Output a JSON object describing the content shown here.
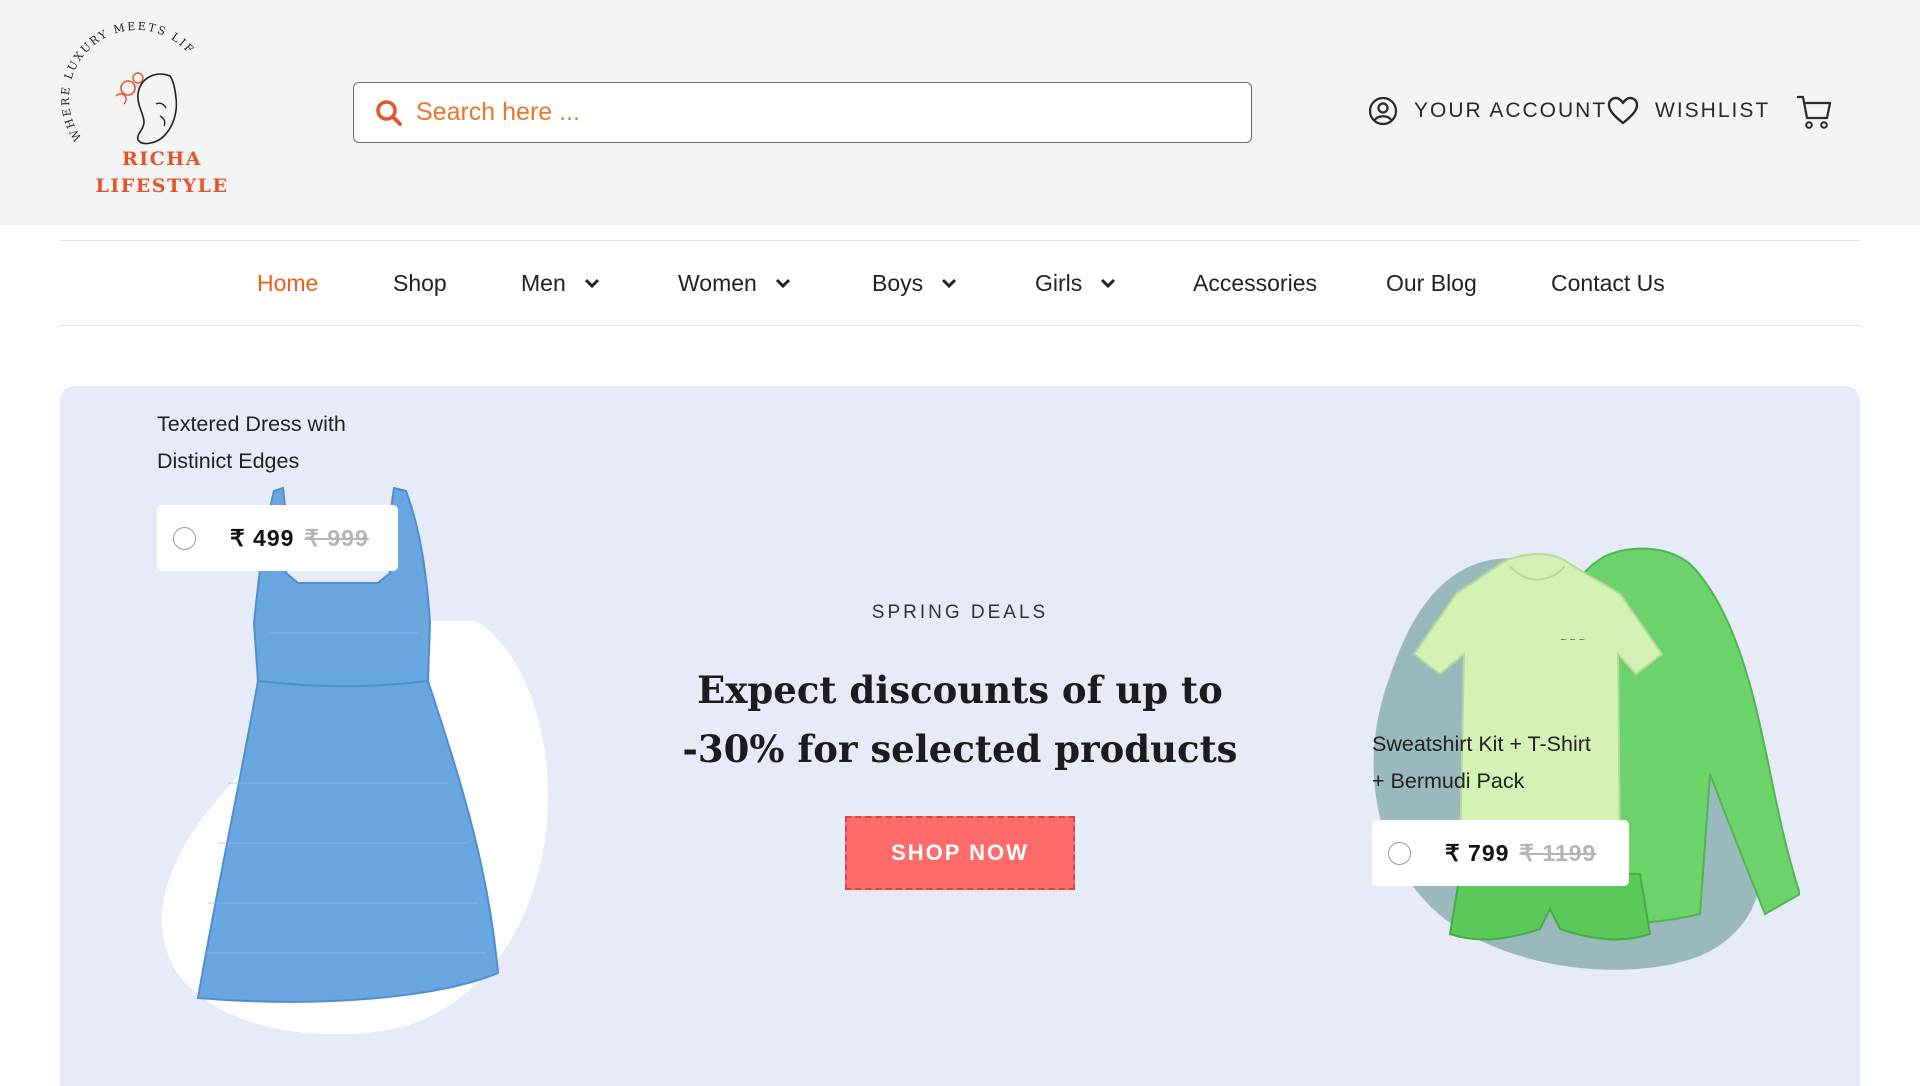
{
  "brand": {
    "name_line1": "RICHA",
    "name_line2": "LIFESTYLE",
    "tagline": "WHERE LUXURY MEETS LIFESTYLE",
    "accent_color": "#e2552a"
  },
  "search": {
    "placeholder": "Search here ...",
    "value": ""
  },
  "header_actions": {
    "account_label": "YOUR ACCOUNT",
    "account_icon": "user-circle-icon",
    "wishlist_label": "WISHLIST",
    "wishlist_icon": "heart-icon",
    "cart_icon": "cart-icon"
  },
  "nav": {
    "items": [
      {
        "label": "Home",
        "active": true,
        "has_dropdown": false
      },
      {
        "label": "Shop",
        "active": false,
        "has_dropdown": false
      },
      {
        "label": "Men",
        "active": false,
        "has_dropdown": true
      },
      {
        "label": "Women",
        "active": false,
        "has_dropdown": true
      },
      {
        "label": "Boys",
        "active": false,
        "has_dropdown": true
      },
      {
        "label": "Girls",
        "active": false,
        "has_dropdown": true
      },
      {
        "label": "Accessories",
        "active": false,
        "has_dropdown": false
      },
      {
        "label": "Our Blog",
        "active": false,
        "has_dropdown": false
      },
      {
        "label": "Contact Us",
        "active": false,
        "has_dropdown": false
      }
    ],
    "active_color": "#ea5f1c"
  },
  "hero": {
    "eyebrow": "SPRING DEALS",
    "headline_line1": "Expect discounts of up to",
    "headline_line2": "-30% for selected products",
    "cta_label": "SHOP NOW",
    "background": "#e6ebf7",
    "cta_color": "#ff6b6b",
    "left_product": {
      "title_line1": "Textered Dress with",
      "title_line2": "Distinict Edges",
      "price": "₹ 499",
      "old_price": "₹ 999"
    },
    "right_product": {
      "title_line1": "Sweatshirt Kit + T-Shirt",
      "title_line2": "+ Bermudi Pack",
      "price": "₹ 799",
      "old_price": "₹ 1199"
    }
  }
}
